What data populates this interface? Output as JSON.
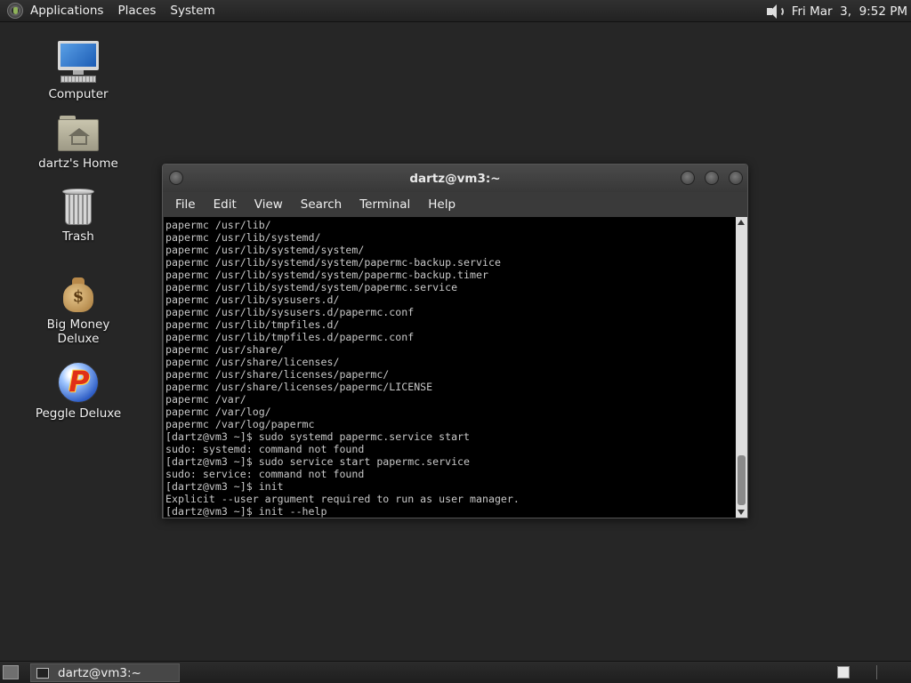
{
  "top_panel": {
    "menus": [
      "Applications",
      "Places",
      "System"
    ],
    "clock": "Fri Mar  3,  9:52 PM"
  },
  "desktop_icons": {
    "computer": "Computer",
    "home": "dartz's Home",
    "trash": "Trash",
    "big_money": "Big Money Deluxe",
    "peggle": "Peggle Deluxe"
  },
  "terminal": {
    "title": "dartz@vm3:~",
    "menus": [
      "File",
      "Edit",
      "View",
      "Search",
      "Terminal",
      "Help"
    ],
    "output": "papermc /usr/lib/\npapermc /usr/lib/systemd/\npapermc /usr/lib/systemd/system/\npapermc /usr/lib/systemd/system/papermc-backup.service\npapermc /usr/lib/systemd/system/papermc-backup.timer\npapermc /usr/lib/systemd/system/papermc.service\npapermc /usr/lib/sysusers.d/\npapermc /usr/lib/sysusers.d/papermc.conf\npapermc /usr/lib/tmpfiles.d/\npapermc /usr/lib/tmpfiles.d/papermc.conf\npapermc /usr/share/\npapermc /usr/share/licenses/\npapermc /usr/share/licenses/papermc/\npapermc /usr/share/licenses/papermc/LICENSE\npapermc /var/\npapermc /var/log/\npapermc /var/log/papermc\n[dartz@vm3 ~]$ sudo systemd papermc.service start\nsudo: systemd: command not found\n[dartz@vm3 ~]$ sudo service start papermc.service\nsudo: service: command not found\n[dartz@vm3 ~]$ init\nExplicit --user argument required to run as user manager.\n[dartz@vm3 ~]$ init --help"
  },
  "taskbar": {
    "terminal_task": "dartz@vm3:~"
  },
  "icons": {
    "foot": "gnome-foot-icon",
    "volume": "volume-icon",
    "show_desktop": "show-desktop-icon",
    "terminal_task": "terminal-icon"
  }
}
